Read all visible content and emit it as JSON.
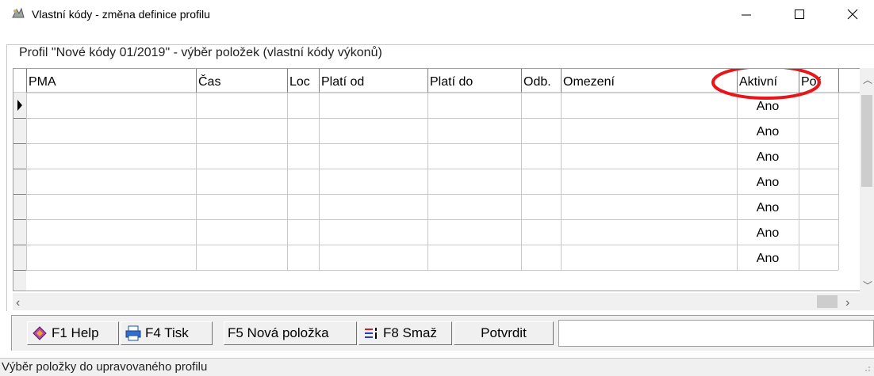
{
  "window": {
    "title": "Vlastní kódy - změna definice profilu",
    "controls": {
      "minimize": "—",
      "maximize": "☐",
      "close": "✕"
    }
  },
  "group_caption": "Profil \"Nové kódy 01/2019\" - výběr položek (vlastní kódy výkonů)",
  "grid": {
    "columns": [
      "PMA",
      "Čas",
      "Loc",
      "Platí od",
      "Platí do",
      "Odb.",
      "Omezení",
      "Aktivní",
      "Poř"
    ],
    "rows": [
      [
        "",
        "",
        "",
        "",
        "",
        "",
        "",
        "Ano",
        ""
      ],
      [
        "",
        "",
        "",
        "",
        "",
        "",
        "",
        "Ano",
        ""
      ],
      [
        "",
        "",
        "",
        "",
        "",
        "",
        "",
        "Ano",
        ""
      ],
      [
        "",
        "",
        "",
        "",
        "",
        "",
        "",
        "Ano",
        ""
      ],
      [
        "",
        "",
        "",
        "",
        "",
        "",
        "",
        "Ano",
        ""
      ],
      [
        "",
        "",
        "",
        "",
        "",
        "",
        "",
        "Ano",
        ""
      ],
      [
        "",
        "",
        "",
        "",
        "",
        "",
        "",
        "Ano",
        ""
      ]
    ],
    "current_row": 0,
    "highlight_color": "#e8151b"
  },
  "toolbar": {
    "f1": "F1 Help",
    "f4": "F4 Tisk",
    "f5": "F5 Nová položka",
    "f8": "F8 Smaž",
    "confirm": "Potvrdit"
  },
  "status": {
    "text": "Výběr položky do upravovaného profilu"
  },
  "icons": {
    "app": "app-icon",
    "help": "help-book-icon",
    "print": "printer-icon",
    "delete": "delete-rows-icon"
  }
}
